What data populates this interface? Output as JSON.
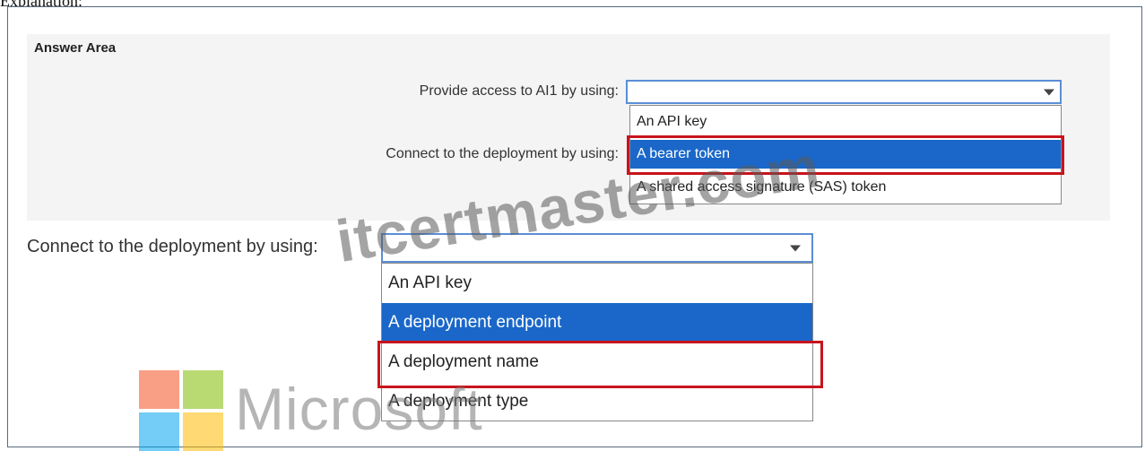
{
  "heading": "Explanation:",
  "answer_area": {
    "title": "Answer Area",
    "q1": {
      "label": "Provide access to AI1 by using:"
    },
    "q2": {
      "label": "Connect to the deployment by using:",
      "options": [
        "An API key",
        "A bearer token",
        "A shared access signature (SAS) token"
      ],
      "selected_index": 1,
      "highlighted_index": 1
    }
  },
  "lower": {
    "label": "Connect to the deployment by using:",
    "options": [
      "An API key",
      "A deployment endpoint",
      "A deployment name",
      "A deployment type"
    ],
    "selected_index": 1,
    "highlighted_index": 2
  },
  "watermark": "itcertmaster.com",
  "logo": {
    "word": "Microsoft",
    "colors": [
      "#f25022",
      "#7fba00",
      "#00a4ef",
      "#ffb900"
    ]
  },
  "colors": {
    "selection": "#1a67c9",
    "highlight_box": "#c8141c",
    "dropdown_border": "#5b8ed6"
  }
}
